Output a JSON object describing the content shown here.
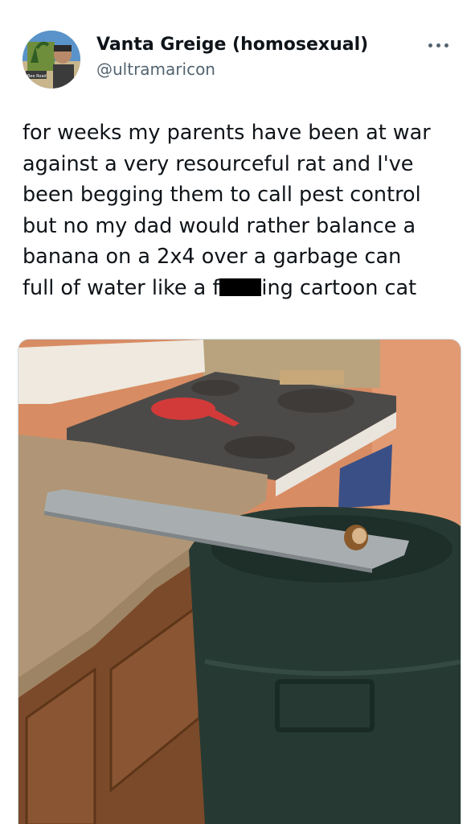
{
  "author": {
    "display_name": "Vanta Greige (homosexual)",
    "handle": "@ultramaricon",
    "avatar_caption": "Bee Road"
  },
  "menu": {
    "icon": "more-horizontal-icon"
  },
  "tweet": {
    "lines": [
      "for weeks my parents have been at war",
      "against a very resourceful rat and I've",
      "been begging them to call pest control",
      "but no my dad would rather balance a",
      "banana on a 2x4 over a garbage can"
    ],
    "last_line_prefix": "full of water like a f",
    "last_line_suffix": "ing cartoon cat"
  },
  "colors": {
    "text": "#0f1419",
    "secondary": "#536471",
    "border": "#cfd9de"
  }
}
